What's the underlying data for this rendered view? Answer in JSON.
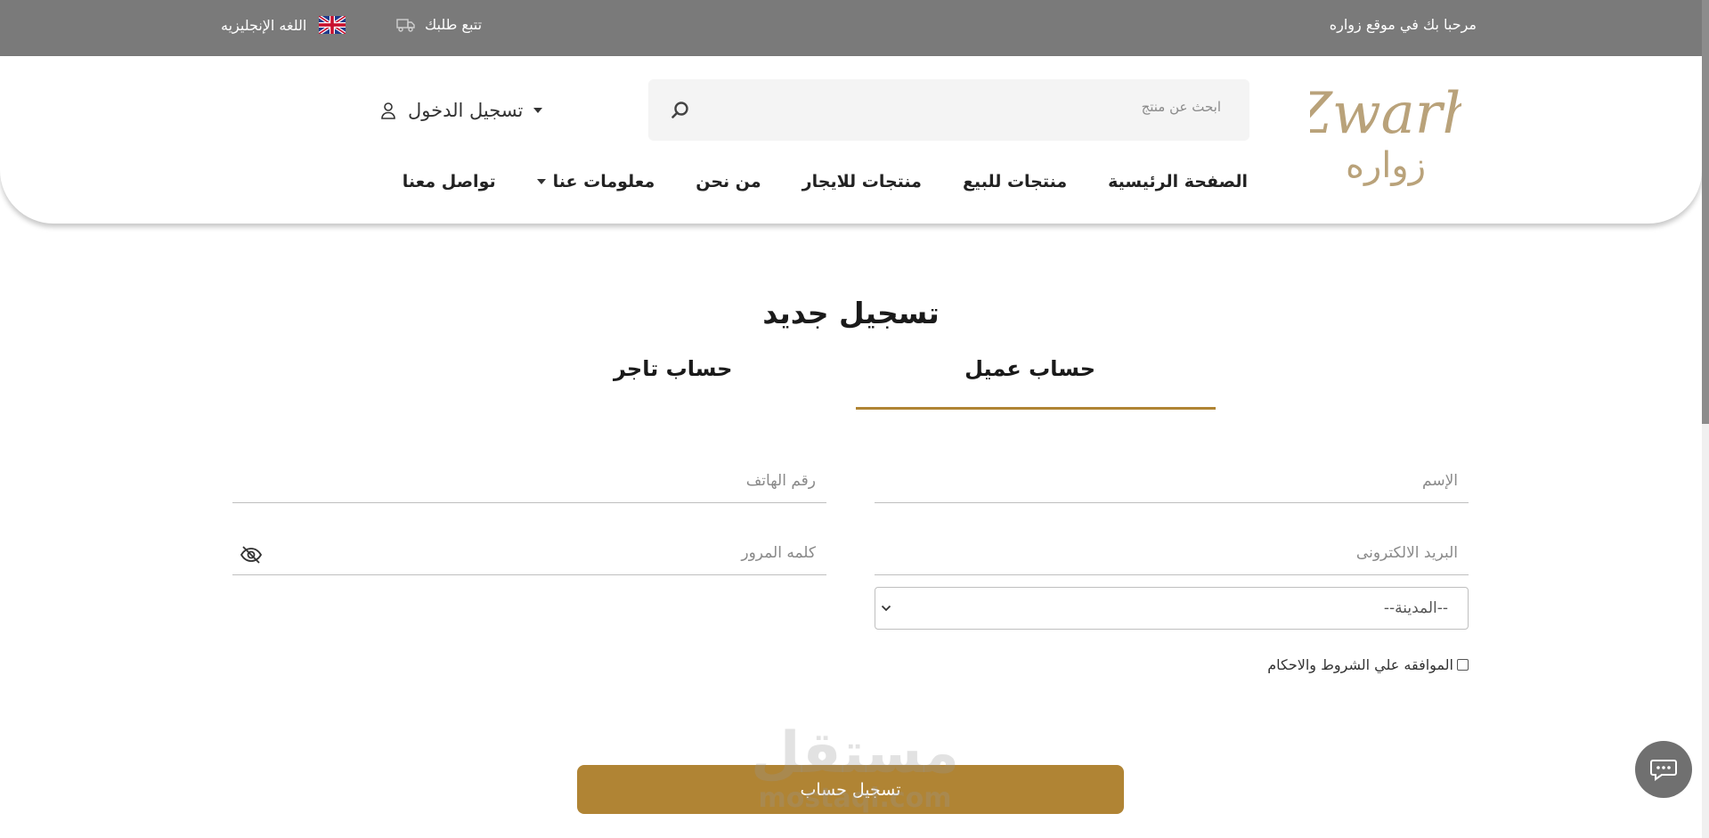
{
  "topbar": {
    "welcome": "مرحبا بك في موقع زواره",
    "track_order": "تتبع طلبك",
    "language": "اللغه الإنجليزيه"
  },
  "header": {
    "logo_text": "Zwarh",
    "logo_ar": "زواره",
    "search_placeholder": "ابحث عن منتج",
    "login_label": "تسجيل الدخول",
    "nav": [
      {
        "label": "الصفحة الرئيسية"
      },
      {
        "label": "منتجات للبيع"
      },
      {
        "label": "منتجات للايجار"
      },
      {
        "label": "من نحن"
      },
      {
        "label": "معلومات عنا"
      },
      {
        "label": "تواصل معنا"
      }
    ]
  },
  "form": {
    "title": "تسجيل جديد",
    "tabs": [
      {
        "label": "حساب عميل",
        "active": true
      },
      {
        "label": "حساب تاجر",
        "active": false
      }
    ],
    "name_placeholder": "الإسم",
    "phone_placeholder": "رقم الهاتف",
    "email_placeholder": "البريد الالكترونى",
    "password_placeholder": "كلمه المرور",
    "city_selected": "--المدينة--",
    "agree_label": "الموافقه علي الشروط والاحكام",
    "submit_label": "تسجيل حساب"
  },
  "watermark": {
    "ar": "مستقل",
    "en": "mostaql.com"
  },
  "colors": {
    "accent": "#b08434",
    "topbar": "#7a7a7a",
    "chat": "#707070"
  },
  "icons": [
    "truck-icon",
    "uk-flag-icon",
    "search-icon",
    "user-icon",
    "eye-off-icon",
    "chevron-down-icon",
    "chat-icon"
  ]
}
